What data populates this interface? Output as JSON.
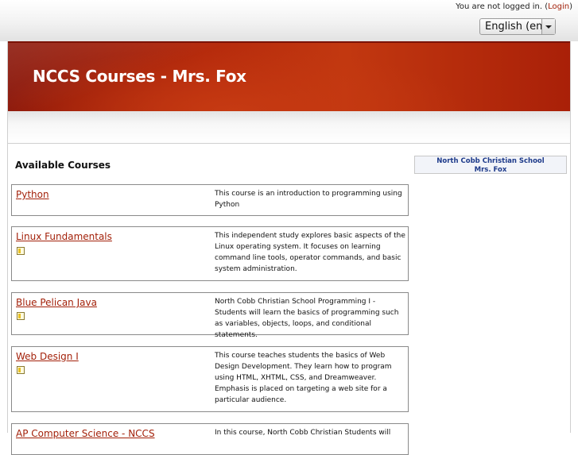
{
  "header": {
    "login_prefix": "You are not logged in. (",
    "login_link": "Login",
    "login_suffix": ")",
    "language": "English (en)",
    "site_title": "NCCS Courses - Mrs. Fox"
  },
  "main": {
    "heading": "Available Courses",
    "courses": [
      {
        "name": "Python",
        "description": "This course is an introduction to programming using Python"
      },
      {
        "name": "Linux Fundamentals",
        "description": "This independent study explores basic aspects of the Linux operating system. It focuses on learning command line tools, operator commands, and basic system administration."
      },
      {
        "name": "Blue Pelican Java",
        "description": "North Cobb Christian School Programming I - Students will learn the basics of programming such as variables, objects, loops, and conditional statements."
      },
      {
        "name": "Web Design I",
        "description": "This course teaches students the basics of Web Design Development. They learn how to program using HTML, XHTML, CSS, and Dreamweaver. Emphasis is placed on targeting a web site for a particular audience."
      },
      {
        "name": "AP Computer Science - NCCS",
        "description": "In this course, North Cobb Christian Students will"
      }
    ]
  },
  "sidebar": {
    "school": "North Cobb Christian School",
    "teacher": "Mrs. Fox"
  },
  "colors": {
    "accent_link": "#a3210a",
    "banner": "#b52a0c"
  },
  "icons": {
    "course_info": "page-icon",
    "dropdown": "chevron-down-icon"
  }
}
